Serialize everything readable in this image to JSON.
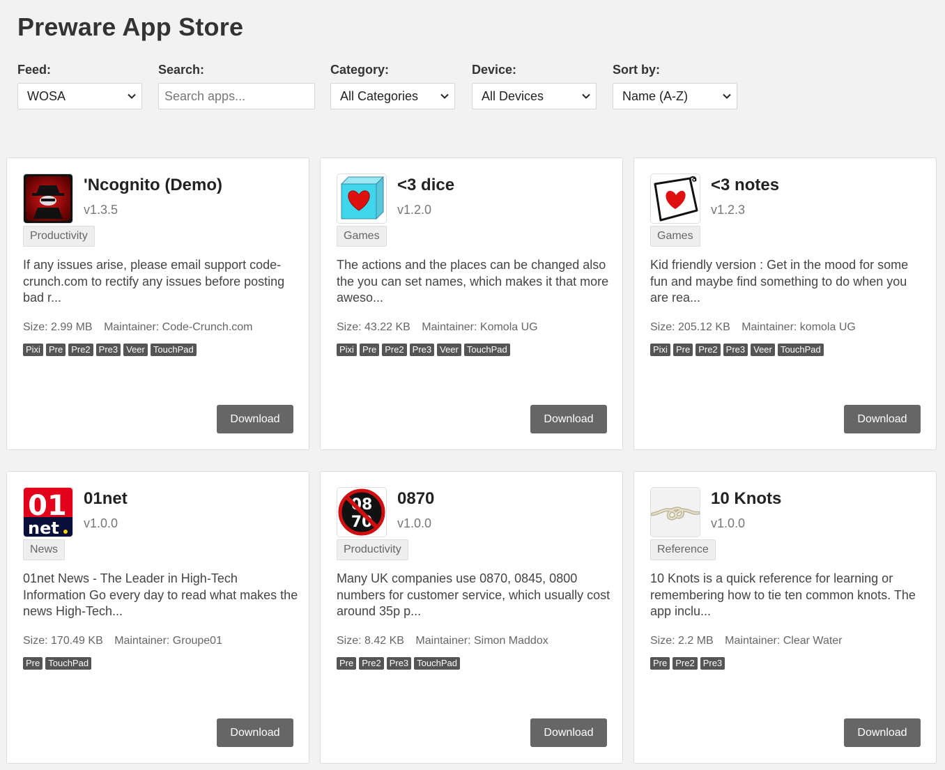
{
  "header": {
    "title": "Preware App Store"
  },
  "filters": {
    "feed": {
      "label": "Feed:",
      "value": "WOSA"
    },
    "search": {
      "label": "Search:",
      "placeholder": "Search apps..."
    },
    "category": {
      "label": "Category:",
      "value": "All Categories"
    },
    "device": {
      "label": "Device:",
      "value": "All Devices"
    },
    "sort": {
      "label": "Sort by:",
      "value": "Name (A-Z)"
    }
  },
  "apps": [
    {
      "name": "'Ncognito (Demo)",
      "version": "v1.3.5",
      "category": "Productivity",
      "description": "If any issues arise, please email support code-crunch.com to rectify any issues before posting bad r...",
      "size": "Size: 2.99 MB",
      "maintainer": "Maintainer: Code-Crunch.com",
      "devices": [
        "Pixi",
        "Pre",
        "Pre2",
        "Pre3",
        "Veer",
        "TouchPad"
      ],
      "download_label": "Download",
      "icon": "spy-icon"
    },
    {
      "name": "<3 dice",
      "version": "v1.2.0",
      "category": "Games",
      "description": "The actions and the places can be changed also the you can set names, which makes it that more aweso...",
      "size": "Size: 43.22 KB",
      "maintainer": "Maintainer: Komola UG",
      "devices": [
        "Pixi",
        "Pre",
        "Pre2",
        "Pre3",
        "Veer",
        "TouchPad"
      ],
      "download_label": "Download",
      "icon": "heart-dice-icon"
    },
    {
      "name": "<3 notes",
      "version": "v1.2.3",
      "category": "Games",
      "description": "Kid friendly version : Get in the mood for some fun and maybe find something to do when you are rea...",
      "size": "Size: 205.12 KB",
      "maintainer": "Maintainer: komola UG",
      "devices": [
        "Pixi",
        "Pre",
        "Pre2",
        "Pre3",
        "Veer",
        "TouchPad"
      ],
      "download_label": "Download",
      "icon": "heart-note-icon"
    },
    {
      "name": "01net",
      "version": "v1.0.0",
      "category": "News",
      "description": "01net News - The Leader in High-Tech Information Go every day to read what makes the news High-Tech...",
      "size": "Size: 170.49 KB",
      "maintainer": "Maintainer: Groupe01",
      "devices": [
        "Pre",
        "TouchPad"
      ],
      "download_label": "Download",
      "icon": "01net-logo-icon",
      "icon_text": {
        "top": "01",
        "bottom": "net"
      }
    },
    {
      "name": "0870",
      "version": "v1.0.0",
      "category": "Productivity",
      "description": "Many UK companies use 0870, 0845, 0800 numbers for customer service, which usually cost around 35p p...",
      "size": "Size: 8.42 KB",
      "maintainer": "Maintainer: Simon Maddox",
      "devices": [
        "Pre",
        "Pre2",
        "Pre3",
        "TouchPad"
      ],
      "download_label": "Download",
      "icon": "no-0870-icon",
      "icon_text": {
        "top": "08",
        "bottom": "70"
      }
    },
    {
      "name": "10 Knots",
      "version": "v1.0.0",
      "category": "Reference",
      "description": "10 Knots is a quick reference for learning or remembering how to tie ten common knots. The app inclu...",
      "size": "Size: 2.2 MB",
      "maintainer": "Maintainer: Clear Water",
      "devices": [
        "Pre",
        "Pre2",
        "Pre3"
      ],
      "download_label": "Download",
      "icon": "knot-icon"
    }
  ]
}
